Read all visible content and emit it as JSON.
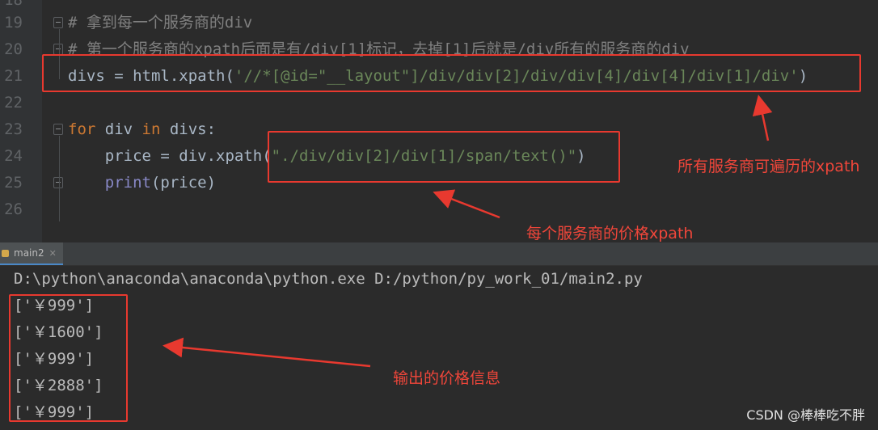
{
  "editor": {
    "lines": [
      {
        "num": "18",
        "parts": []
      },
      {
        "num": "19",
        "parts": [
          {
            "t": "# 拿到每一个服务商的div",
            "c": "comment"
          }
        ]
      },
      {
        "num": "20",
        "parts": [
          {
            "t": "# 第一个服务商的xpath后面是有/div[1]标记，去掉[1]后就是/div所有的服务商的div",
            "c": "comment"
          }
        ]
      },
      {
        "num": "21",
        "parts": [
          {
            "t": "divs = html.xpath(",
            "c": ""
          },
          {
            "t": "'//*[@id=\"__layout\"]/div/div[2]/div/div[4]/div[4]/div[1]/div'",
            "c": "str"
          },
          {
            "t": ")",
            "c": ""
          }
        ]
      },
      {
        "num": "22",
        "parts": []
      },
      {
        "num": "23",
        "parts": [
          {
            "t": "for ",
            "c": "kw"
          },
          {
            "t": "div ",
            "c": ""
          },
          {
            "t": "in ",
            "c": "kw"
          },
          {
            "t": "divs:",
            "c": ""
          }
        ]
      },
      {
        "num": "24",
        "parts": [
          {
            "t": "    price = div.xpath(",
            "c": ""
          },
          {
            "t": "\"./div/div[2]/div[1]/span/text()\"",
            "c": "str"
          },
          {
            "t": ")",
            "c": ""
          }
        ]
      },
      {
        "num": "25",
        "parts": [
          {
            "t": "    ",
            "c": ""
          },
          {
            "t": "print",
            "c": "bi"
          },
          {
            "t": "(price)",
            "c": ""
          }
        ]
      },
      {
        "num": "26",
        "parts": []
      }
    ]
  },
  "annotations": {
    "all_providers": "所有服务商可遍历的xpath",
    "each_price": "每个服务商的价格xpath",
    "output_info": "输出的价格信息"
  },
  "run_tab": {
    "label": "main2"
  },
  "console": {
    "command": "D:\\python\\anaconda\\anaconda\\python.exe D:/python/py_work_01/main2.py",
    "outputs": [
      "['￥999']",
      "['￥1600']",
      "['￥999']",
      "['￥2888']",
      "['￥999']"
    ]
  },
  "watermark": "CSDN @棒棒吃不胖",
  "colors": {
    "annotation": "#e8392f",
    "background": "#2b2b2b"
  }
}
